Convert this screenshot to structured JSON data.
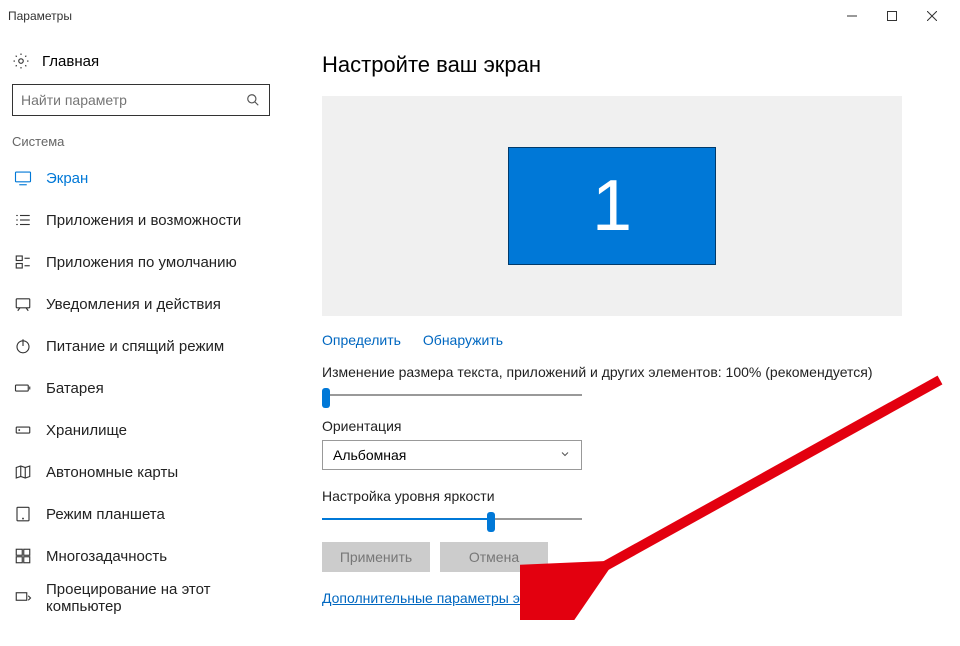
{
  "window": {
    "title": "Параметры"
  },
  "sidebar": {
    "home": "Главная",
    "search_placeholder": "Найти параметр",
    "category": "Система",
    "items": [
      {
        "label": "Экран"
      },
      {
        "label": "Приложения и возможности"
      },
      {
        "label": "Приложения по умолчанию"
      },
      {
        "label": "Уведомления и действия"
      },
      {
        "label": "Питание и спящий режим"
      },
      {
        "label": "Батарея"
      },
      {
        "label": "Хранилище"
      },
      {
        "label": "Автономные карты"
      },
      {
        "label": "Режим планшета"
      },
      {
        "label": "Многозадачность"
      },
      {
        "label": "Проецирование на этот компьютер"
      }
    ]
  },
  "main": {
    "title": "Настройте ваш экран",
    "monitor_number": "1",
    "identify_link": "Определить",
    "detect_link": "Обнаружить",
    "scale_label": "Изменение размера текста, приложений и других элементов: 100% (рекомендуется)",
    "scale_slider_pct": 0,
    "orientation_label": "Ориентация",
    "orientation_value": "Альбомная",
    "brightness_label": "Настройка уровня яркости",
    "brightness_slider_pct": 65,
    "apply_btn": "Применить",
    "cancel_btn": "Отмена",
    "advanced_link": "Дополнительные параметры экрана"
  }
}
